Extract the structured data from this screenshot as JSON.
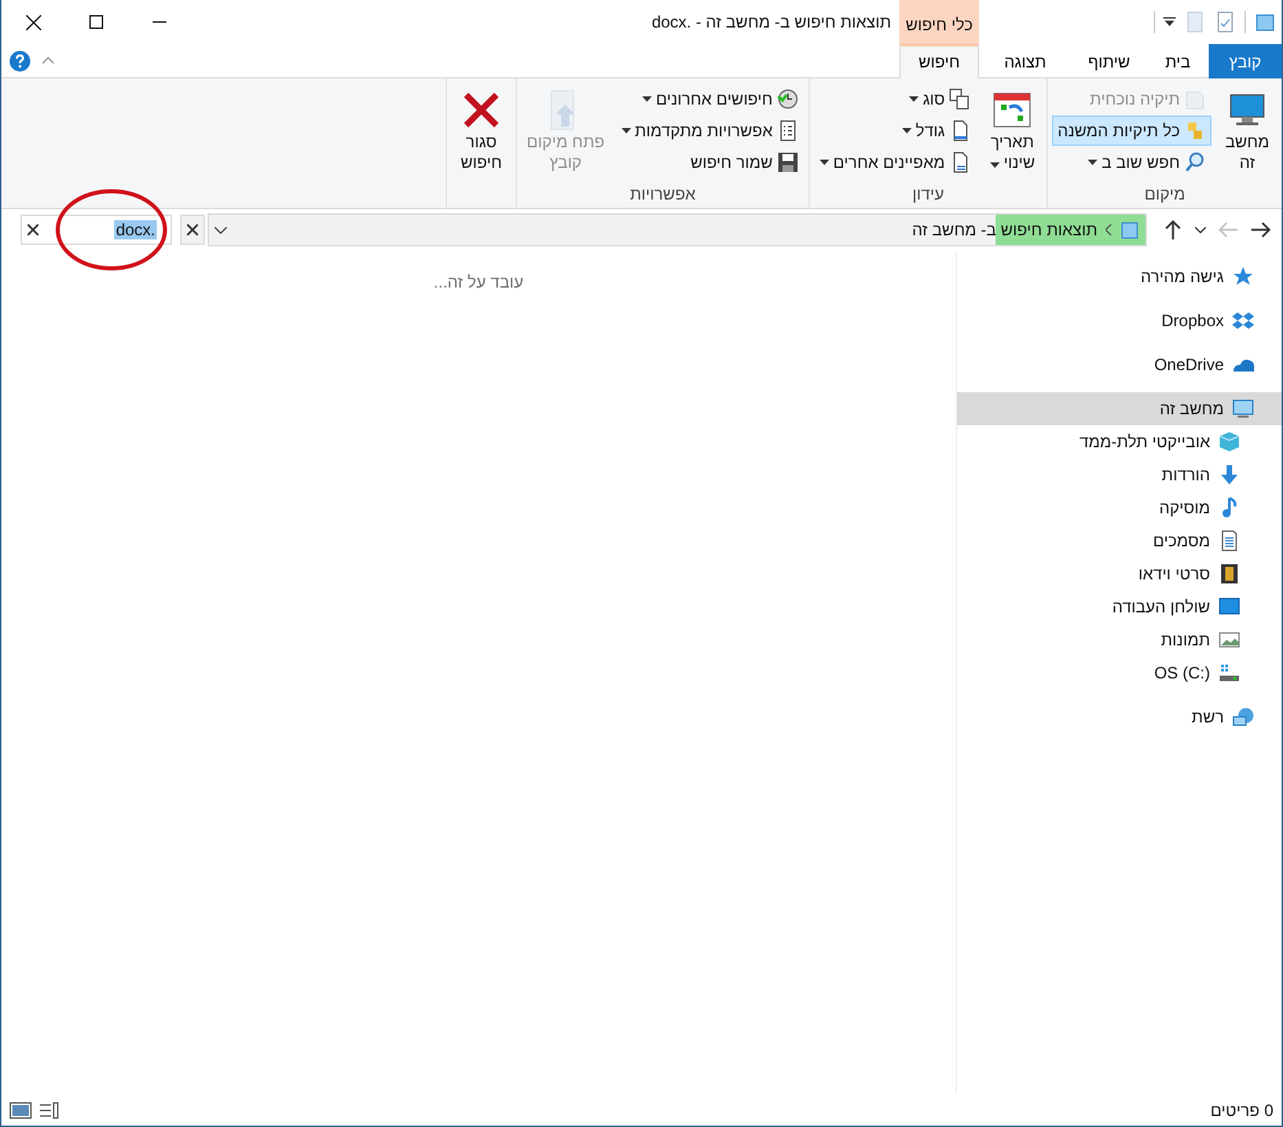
{
  "window": {
    "title": "docx. - תוצאות חיפוש ב- מחשב זה",
    "contextual_tab": "כלי חיפוש"
  },
  "tabs": [
    {
      "label": "קובץ",
      "kind": "file",
      "selected": false
    },
    {
      "label": "בית",
      "kind": "tab",
      "selected": false
    },
    {
      "label": "שיתוף",
      "kind": "tab",
      "selected": false
    },
    {
      "label": "תצוגה",
      "kind": "tab",
      "selected": false
    },
    {
      "label": "חיפוש",
      "kind": "contextual",
      "selected": true
    }
  ],
  "ribbon": {
    "groups": [
      {
        "label": "מיקום",
        "columns": [
          {
            "buttons": [
              {
                "kind": "large",
                "lines": [
                  "מחשב",
                  "זה"
                ],
                "disabled": false,
                "dropdown": false,
                "selected": false
              }
            ]
          },
          {
            "buttons": [
              {
                "kind": "small",
                "label": "תיקיה נוכחית",
                "disabled": true,
                "dropdown": false,
                "selected": false
              },
              {
                "kind": "small",
                "label": "כל תיקיות המשנה",
                "disabled": false,
                "dropdown": false,
                "selected": true
              },
              {
                "kind": "small",
                "label": "חפש שוב ב",
                "disabled": false,
                "dropdown": true,
                "selected": false
              }
            ]
          }
        ]
      },
      {
        "label": "עידון",
        "columns": [
          {
            "buttons": [
              {
                "kind": "large",
                "lines": [
                  "תאריך",
                  "שינוי"
                ],
                "disabled": false,
                "dropdown": true,
                "selected": false
              }
            ]
          },
          {
            "buttons": [
              {
                "kind": "small",
                "label": "סוג",
                "disabled": false,
                "dropdown": true,
                "selected": false
              },
              {
                "kind": "small",
                "label": "גודל",
                "disabled": false,
                "dropdown": true,
                "selected": false
              },
              {
                "kind": "small",
                "label": "מאפיינים אחרים",
                "disabled": false,
                "dropdown": true,
                "selected": false
              }
            ]
          }
        ]
      },
      {
        "label": "אפשרויות",
        "columns": [
          {
            "buttons": [
              {
                "kind": "small",
                "label": "חיפושים אחרונים",
                "disabled": false,
                "dropdown": true,
                "selected": false
              },
              {
                "kind": "small",
                "label": "אפשרויות מתקדמות",
                "disabled": false,
                "dropdown": true,
                "selected": false
              },
              {
                "kind": "small",
                "label": "שמור חיפוש",
                "disabled": false,
                "dropdown": false,
                "selected": false
              }
            ]
          },
          {
            "buttons": [
              {
                "kind": "large",
                "lines": [
                  "פתח מיקום",
                  "קובץ"
                ],
                "disabled": true,
                "dropdown": false,
                "selected": false
              }
            ]
          }
        ]
      },
      {
        "columns": [
          {
            "buttons": [
              {
                "kind": "large",
                "lines": [
                  "סגור",
                  "חיפוש"
                ],
                "disabled": false,
                "dropdown": false,
                "selected": false
              }
            ]
          }
        ]
      }
    ]
  },
  "navigation": [
    {
      "kind": "back",
      "disabled": false
    },
    {
      "kind": "forward",
      "disabled": true
    },
    {
      "kind": "recent",
      "disabled": false
    },
    {
      "kind": "up",
      "disabled": false
    }
  ],
  "address_bar": {
    "location": "תוצאות חיפוש ב- מחשב זה",
    "level": 0.16
  },
  "search": {
    "value": "docx."
  },
  "content": {
    "status_message": "עובד על זה..."
  },
  "sidebar": {
    "items": [
      {
        "label": "גישה מהירה",
        "selected": false
      },
      {
        "label": "Dropbox",
        "selected": false
      },
      {
        "label": "OneDrive",
        "selected": false
      },
      {
        "label": "מחשב זה",
        "selected": true,
        "children": [
          {
            "label": "אובייקטי תלת-ממד",
            "selected": false
          },
          {
            "label": "הורדות",
            "selected": false
          },
          {
            "label": "מוסיקה",
            "selected": false
          },
          {
            "label": "מסמכים",
            "selected": false
          },
          {
            "label": "סרטי וידאו",
            "selected": false
          },
          {
            "label": "שולחן העבודה",
            "selected": false
          },
          {
            "label": "תמונות",
            "selected": false
          },
          {
            "label": "OS (C:)",
            "selected": false
          }
        ]
      },
      {
        "label": "רשת",
        "selected": false
      }
    ]
  },
  "status_bar": {
    "item_count": "0 פריטים"
  }
}
